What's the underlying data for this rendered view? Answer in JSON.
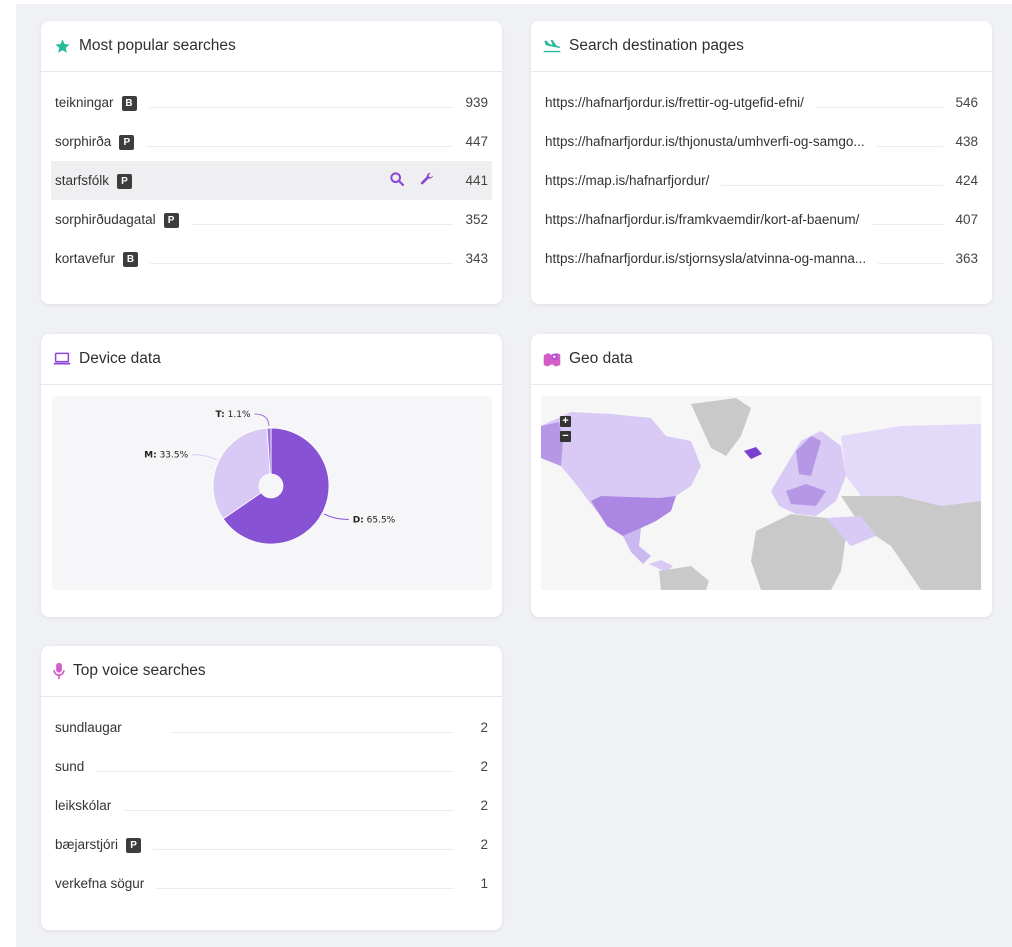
{
  "popular": {
    "title": "Most popular searches",
    "rows": [
      {
        "label": "teikningar",
        "badge": "B",
        "count": "939"
      },
      {
        "label": "sorphirða",
        "badge": "P",
        "count": "447"
      },
      {
        "label": "starfsfólk",
        "badge": "P",
        "count": "441"
      },
      {
        "label": "sorphirðudagatal",
        "badge": "P",
        "count": "352"
      },
      {
        "label": "kortavefur",
        "badge": "B",
        "count": "343"
      }
    ]
  },
  "destinations": {
    "title": "Search destination pages",
    "rows": [
      {
        "label": "https://hafnarfjordur.is/frettir-og-utgefid-efni/",
        "count": "546"
      },
      {
        "label": "https://hafnarfjordur.is/thjonusta/umhverfi-og-samgo...",
        "count": "438"
      },
      {
        "label": "https://map.is/hafnarfjordur/",
        "count": "424"
      },
      {
        "label": "https://hafnarfjordur.is/framkvaemdir/kort-af-baenum/",
        "count": "407"
      },
      {
        "label": "https://hafnarfjordur.is/stjornsysla/atvinna-og-manna...",
        "count": "363"
      }
    ]
  },
  "device": {
    "title": "Device data",
    "chart_data": {
      "type": "pie",
      "slices": [
        {
          "label": "D: 65.5%",
          "value": 65.5,
          "color": "#8752d4"
        },
        {
          "label": "M: 33.5%",
          "value": 33.5,
          "color": "#d8c9f5"
        },
        {
          "label": "T: 1.1%",
          "value": 1.1,
          "color": "#a070dc"
        }
      ]
    }
  },
  "geo": {
    "title": "Geo data",
    "zoom_in": "+",
    "zoom_out": "−"
  },
  "voice": {
    "title": "Top voice searches",
    "rows": [
      {
        "label": "sundlaugar",
        "badge": "",
        "count": "2"
      },
      {
        "label": "sund",
        "badge": "",
        "count": "2"
      },
      {
        "label": "leikskólar",
        "badge": "",
        "count": "2"
      },
      {
        "label": "bæjarstjóri",
        "badge": "P",
        "count": "2"
      },
      {
        "label": "verkefna sögur",
        "badge": "",
        "count": "1"
      }
    ]
  },
  "colors": {
    "accent": "#8e44d6",
    "teal": "#26b99a",
    "pink": "#d45cc6"
  }
}
